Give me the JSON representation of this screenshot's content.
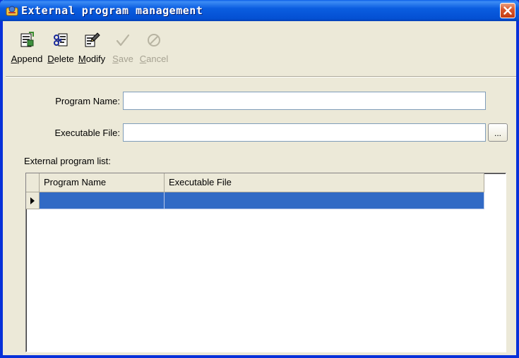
{
  "window": {
    "title": "External program management"
  },
  "toolbar": {
    "buttons": [
      {
        "accel": "A",
        "rest": "ppend",
        "icon": "append-icon",
        "enabled": true
      },
      {
        "accel": "D",
        "rest": "elete",
        "icon": "delete-icon",
        "enabled": true
      },
      {
        "accel": "M",
        "rest": "odify",
        "icon": "modify-icon",
        "enabled": true
      },
      {
        "accel": "S",
        "rest": "ave",
        "icon": "checkmark-icon",
        "enabled": false
      },
      {
        "accel": "C",
        "rest": "ancel",
        "icon": "cancel-icon",
        "enabled": false
      }
    ]
  },
  "form": {
    "program_name_label": "Program Name:",
    "program_name_value": "",
    "executable_file_label": "Executable File:",
    "executable_file_value": "",
    "browse_label": "..."
  },
  "list": {
    "caption": "External program list:",
    "columns": [
      "Program Name",
      "Executable File"
    ],
    "rows": [
      {
        "program_name": "",
        "executable_file": "",
        "selected": true
      }
    ]
  },
  "colors": {
    "selection": "#316ac5",
    "titlebar": "#0a5de0",
    "close_button": "#d9582e"
  }
}
